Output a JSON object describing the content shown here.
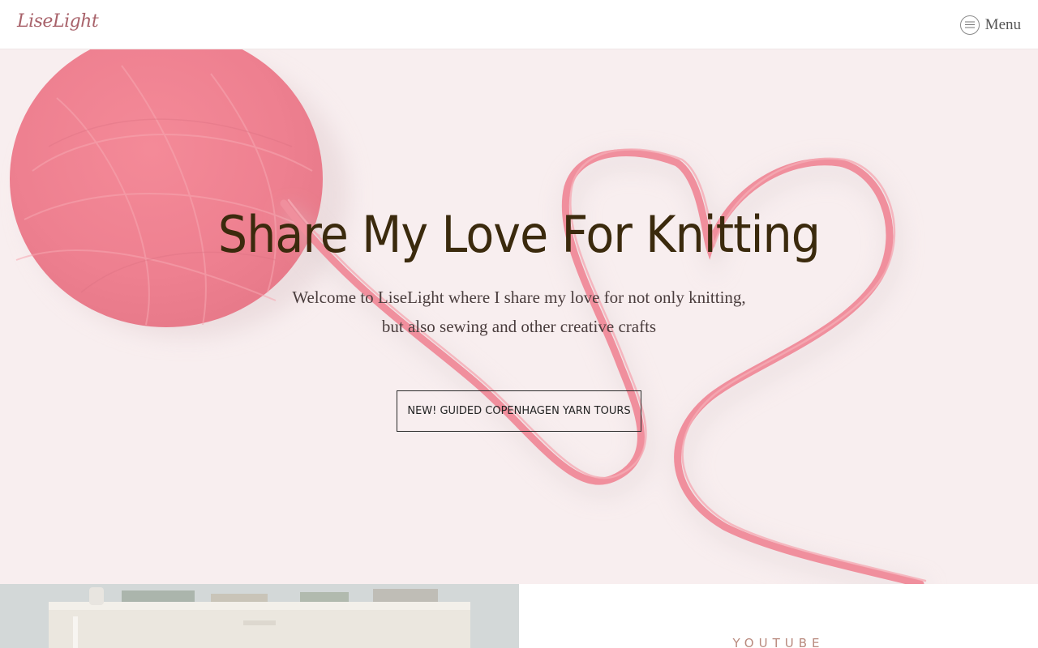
{
  "header": {
    "logo_text": "LiseLight",
    "menu_label": "Menu"
  },
  "hero": {
    "title": "Share My Love For Knitting",
    "subtitle": "Welcome to LiseLight where I share my love for not only knitting, but also sewing and other creative crafts",
    "cta_label": "NEW! GUIDED COPENHAGEN YARN TOURS"
  },
  "section": {
    "label": "YOUTUBE"
  },
  "colors": {
    "logo": "#a8626a",
    "hero_bg": "#f8eeef",
    "yarn": "#f0909c",
    "title": "#3b2a0d",
    "section_label": "#b98a7e"
  },
  "icons": {
    "menu": "hamburger-circle-icon"
  }
}
